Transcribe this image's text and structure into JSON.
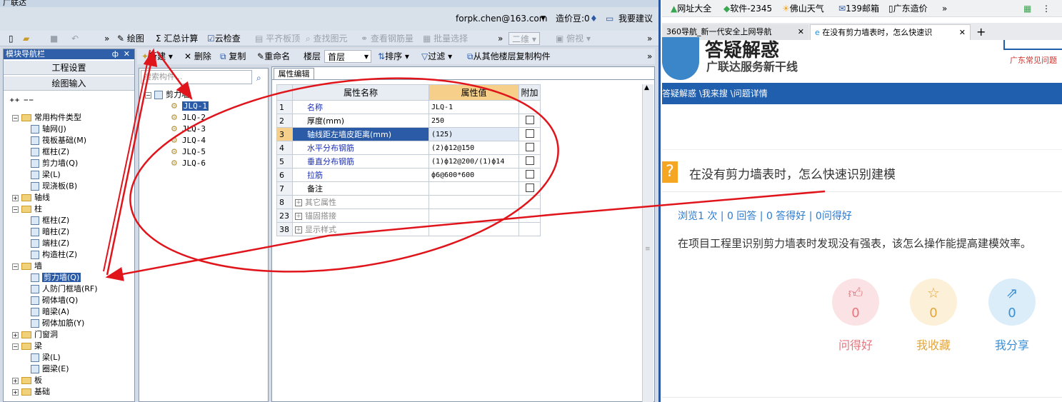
{
  "app": {
    "title": "广联达",
    "account": {
      "email": "forpk.chen@163.com",
      "coins": "造价豆:0",
      "feedback": "我要建议"
    },
    "toolbar": {
      "draw": "绘图",
      "sum": "汇总计算",
      "cloud_check": "云检查",
      "level_slab": "平齐板顶",
      "find_elem": "查找图元",
      "view_rebar": "查看钢筋量",
      "batch_select": "批量选择",
      "view_2d": "二维",
      "view_top": "俯视"
    },
    "nav": {
      "title": "模块导航栏",
      "pin": "ф",
      "btn_project": "工程设置",
      "btn_drawing": "绘图输入",
      "tree": [
        {
          "label": "常用构件类型",
          "level": 0,
          "type": "folder",
          "exp": "−"
        },
        {
          "label": "轴网(J)",
          "level": 1,
          "type": "leaf"
        },
        {
          "label": "筏板基础(M)",
          "level": 1,
          "type": "leaf"
        },
        {
          "label": "框柱(Z)",
          "level": 1,
          "type": "leaf"
        },
        {
          "label": "剪力墙(Q)",
          "level": 1,
          "type": "leaf"
        },
        {
          "label": "梁(L)",
          "level": 1,
          "type": "leaf"
        },
        {
          "label": "现浇板(B)",
          "level": 1,
          "type": "leaf"
        },
        {
          "label": "轴线",
          "level": 0,
          "type": "folder",
          "exp": "+"
        },
        {
          "label": "柱",
          "level": 0,
          "type": "folder",
          "exp": "−"
        },
        {
          "label": "框柱(Z)",
          "level": 1,
          "type": "leaf"
        },
        {
          "label": "暗柱(Z)",
          "level": 1,
          "type": "leaf"
        },
        {
          "label": "端柱(Z)",
          "level": 1,
          "type": "leaf"
        },
        {
          "label": "构造柱(Z)",
          "level": 1,
          "type": "leaf"
        },
        {
          "label": "墙",
          "level": 0,
          "type": "folder",
          "exp": "−"
        },
        {
          "label": "剪力墙(Q)",
          "level": 1,
          "type": "leaf",
          "selected": true
        },
        {
          "label": "人防门框墙(RF)",
          "level": 1,
          "type": "leaf"
        },
        {
          "label": "砌体墙(Q)",
          "level": 1,
          "type": "leaf"
        },
        {
          "label": "暗梁(A)",
          "level": 1,
          "type": "leaf"
        },
        {
          "label": "砌体加筋(Y)",
          "level": 1,
          "type": "leaf"
        },
        {
          "label": "门窗洞",
          "level": 0,
          "type": "folder",
          "exp": "+"
        },
        {
          "label": "梁",
          "level": 0,
          "type": "folder",
          "exp": "−"
        },
        {
          "label": "梁(L)",
          "level": 1,
          "type": "leaf"
        },
        {
          "label": "圈梁(E)",
          "level": 1,
          "type": "leaf"
        },
        {
          "label": "板",
          "level": 0,
          "type": "folder",
          "exp": "+"
        },
        {
          "label": "基础",
          "level": 0,
          "type": "folder",
          "exp": "+"
        }
      ]
    },
    "subtoolbar": {
      "new": "新建",
      "delete": "删除",
      "copy": "复制",
      "rename": "重命名",
      "floor_label": "楼层",
      "floor_value": "首层",
      "sort": "排序",
      "filter": "过滤",
      "copy_from_floor": "从其他楼层复制构件"
    },
    "components": {
      "search_placeholder": "搜索构件...",
      "root": "剪力墙",
      "items": [
        "JLQ-1",
        "JLQ-2",
        "JLQ-3",
        "JLQ-4",
        "JLQ-5",
        "JLQ-6"
      ]
    },
    "props": {
      "tab": "属性编辑",
      "headers": [
        "属性名称",
        "属性值",
        "附加"
      ],
      "rows": [
        {
          "no": "1",
          "name": "名称",
          "value": "JLQ-1",
          "check": false,
          "name_style": "blue"
        },
        {
          "no": "2",
          "name": "厚度(mm)",
          "value": "250",
          "check": true,
          "name_style": "normal"
        },
        {
          "no": "3",
          "name": "轴线距左墙皮距离(mm)",
          "value": "(125)",
          "check": true,
          "name_style": "selected"
        },
        {
          "no": "4",
          "name": "水平分布钢筋",
          "value": "(2)ф12@150",
          "check": true,
          "name_style": "blue"
        },
        {
          "no": "5",
          "name": "垂直分布钢筋",
          "value": "(1)ф12@200/(1)ф14",
          "check": true,
          "name_style": "blue"
        },
        {
          "no": "6",
          "name": "拉筋",
          "value": "ф6@600*600",
          "check": true,
          "name_style": "blue"
        },
        {
          "no": "7",
          "name": "备注",
          "value": "",
          "check": true,
          "name_style": "normal"
        },
        {
          "no": "8",
          "name": "其它属性",
          "value": "",
          "check": false,
          "name_style": "group"
        },
        {
          "no": "23",
          "name": "锚固搭接",
          "value": "",
          "check": false,
          "name_style": "group"
        },
        {
          "no": "38",
          "name": "显示样式",
          "value": "",
          "check": false,
          "name_style": "group"
        }
      ]
    }
  },
  "browser": {
    "bookmarks": [
      "网址大全",
      "软件-2345",
      "佛山天气",
      "139邮箱",
      "广东造价"
    ],
    "tabs": [
      {
        "title": "360导航_新一代安全上网导航",
        "active": false
      },
      {
        "title": "在没有剪力墙表时，怎么快速识",
        "active": true
      }
    ],
    "site": {
      "logo_text": "答疑解惑",
      "tagline": "广联达服务新干线",
      "corner_link": "广东常见问题",
      "breadcrumb": "答疑解惑 \\我来搜 \\问题详情"
    },
    "question": {
      "icon": "?",
      "title": "在没有剪力墙表时，怎么快速识别建模",
      "stats": "浏览1 次 | 0 回答 | 0 答得好 | 0问得好",
      "body": "在项目工程里识别剪力墙表时发现没有强表，该怎么操作能提高建模效率。"
    },
    "actions": [
      {
        "label": "问得好",
        "count": "0",
        "color": "#e8747c",
        "bg": "#fbe3e5",
        "icon": "thumbs-up-icon"
      },
      {
        "label": "我收藏",
        "count": "0",
        "color": "#e3a63a",
        "bg": "#fdf0d8",
        "icon": "star-icon"
      },
      {
        "label": "我分享",
        "count": "0",
        "color": "#3b8fd6",
        "bg": "#dcedfa",
        "icon": "share-icon"
      }
    ]
  },
  "colors": {
    "annotation": "#e0141b",
    "nav_selected": "#2b5aa6",
    "browser_bar": "#1f5fae"
  }
}
